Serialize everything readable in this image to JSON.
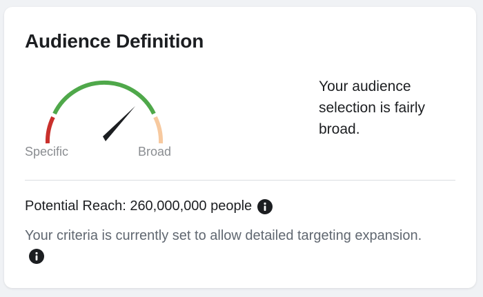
{
  "card": {
    "title": "Audience Definition",
    "gauge": {
      "label_specific": "Specific",
      "label_broad": "Broad",
      "level_fraction": 0.72,
      "colors": {
        "specific": "#c9302c",
        "middle": "#4fa84a",
        "broad": "#f7c99f",
        "needle": "#1c1e21"
      }
    },
    "description": "Your audience selection is fairly broad.",
    "reach": {
      "text": "Potential Reach: 260,000,000 people",
      "icon": "info-icon"
    },
    "criteria": {
      "text": "Your criteria is currently set to allow detailed targeting expansion.",
      "icon": "info-icon"
    }
  }
}
